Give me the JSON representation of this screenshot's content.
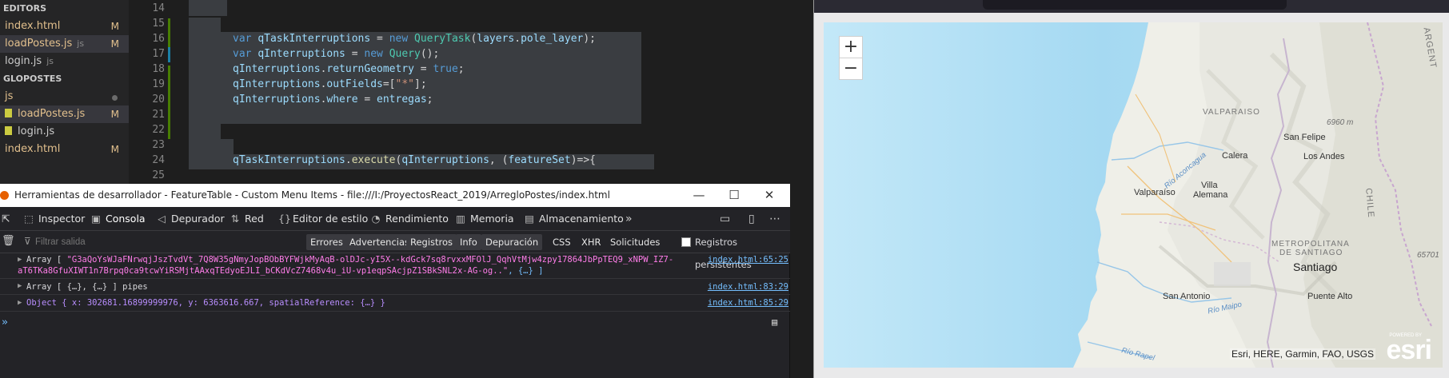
{
  "sidebar": {
    "editors_header": "EDITORS",
    "open_editors": [
      {
        "name": "index.html",
        "status": "M"
      },
      {
        "name": "loadPostes.js",
        "tag": "js",
        "status": "M"
      },
      {
        "name": "login.js",
        "tag": "js"
      }
    ],
    "project_header": "GLOPOSTES",
    "files": [
      {
        "name": "js"
      },
      {
        "name": "loadPostes.js",
        "status": "M"
      },
      {
        "name": "login.js"
      },
      {
        "name": "index.html",
        "status": "M"
      }
    ]
  },
  "editor": {
    "lines": [
      {
        "num": "14",
        "code": ""
      },
      {
        "num": "15",
        "code": ""
      },
      {
        "num": "16",
        "code": "var qTaskInterruptions = new QueryTask(layers.pole_layer);"
      },
      {
        "num": "17",
        "code": "var qInterruptions = new Query();"
      },
      {
        "num": "18",
        "code": "qInterruptions.returnGeometry = true;"
      },
      {
        "num": "19",
        "code": "qInterruptions.outFields=[\"*\"];"
      },
      {
        "num": "20",
        "code": "qInterruptions.where = entregas;"
      },
      {
        "num": "21",
        "code": ""
      },
      {
        "num": "22",
        "code": ""
      },
      {
        "num": "23",
        "code": ""
      },
      {
        "num": "24",
        "code": "qTaskInterruptions.execute(qInterruptions, (featureSet)=>{"
      },
      {
        "num": "25",
        "code": ""
      }
    ]
  },
  "devtools": {
    "window_title": "Herramientas de desarrollador - FeatureTable - Custom Menu Items - file:///I:/ProyectosReact_2019/ArregloPostes/index.html",
    "window_controls": {
      "minimize": "—",
      "maximize": "☐",
      "close": "✕"
    },
    "tabs": [
      {
        "label": "Inspector",
        "icon": "inspector-icon",
        "glyph": "⬚"
      },
      {
        "label": "Consola",
        "icon": "console-icon",
        "glyph": "▣",
        "active": true
      },
      {
        "label": "Depurador",
        "icon": "debugger-icon",
        "glyph": "◁"
      },
      {
        "label": "Red",
        "icon": "network-icon",
        "glyph": "⇅"
      },
      {
        "label": "Editor de estilo",
        "icon": "style-editor-icon",
        "glyph": "{}"
      },
      {
        "label": "Rendimiento",
        "icon": "performance-icon",
        "glyph": "◔"
      },
      {
        "label": "Memoria",
        "icon": "memory-icon",
        "glyph": "▥"
      },
      {
        "label": "Almacenamiento",
        "icon": "storage-icon",
        "glyph": "▤"
      }
    ],
    "filter": {
      "placeholder": "Filtrar salida",
      "levels": [
        "Errores",
        "Advertencias",
        "Registros",
        "Info",
        "Depuración"
      ],
      "types": [
        "CSS",
        "XHR",
        "Solicitudes"
      ],
      "persist_label": "Registros persistentes"
    },
    "logs": [
      {
        "prefix": "Array [ ",
        "value": "\"G3aQoYsWJaFNrwqjJszTvdVt_7Q8W35gNmyJopBObBYFWjkMyAqB-olDJc-yI5X--kdGck7sq8rvxxMFOlJ_QqhVtMjw4zpy17864JbPpTEQ9_xNPW_IZ7-",
        "value2": "aT6TKa8GfuXIWT1n7Brpq0ca9tcwYiRSMjtAAxqTEdyoEJLI_bCKdVcZ7468v4u_iU-vp1eqpSAcjpZ1SBkSNL2x-AG-og..\"",
        "suffix": ", {…} ]",
        "source": "index.html:65:25"
      },
      {
        "text": "Array [ {…}, {…} ] pipes",
        "source": "index.html:83:29"
      },
      {
        "text": "Object { x: 302681.16899999976, y: 6363616.667, spatialReference: {…} }",
        "source": "index.html:85:29"
      }
    ],
    "prompt": "»"
  },
  "map": {
    "zoom_in": "+",
    "zoom_out": "−",
    "places": {
      "valparaiso_region": "VALPARAISO",
      "elev1": "6960 m",
      "san_felipe": "San Felipe",
      "calera": "Calera",
      "los_andes": "Los Andes",
      "rio_aconcagua": "Río Aconcagua",
      "villa_alemana_1": "Villa",
      "villa_alemana_2": "Alemana",
      "valparaiso": "Valparaíso",
      "chile": "CHILE",
      "argentina": "ARGENT",
      "metro_1": "METROPOLITANA",
      "metro_2": "DE SANTIAGO",
      "elev2": "65701",
      "santiago": "Santiago",
      "san_antonio": "San Antonio",
      "puente_alto": "Puente Alto",
      "rio_maipo": "Río Maipo",
      "rio_rapel": "Río Rapel"
    },
    "attribution": "Esri, HERE, Garmin, FAO, USGS",
    "logo": "esri",
    "powered_by": "POWERED BY"
  }
}
